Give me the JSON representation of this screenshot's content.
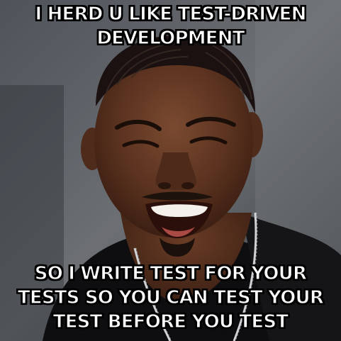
{
  "meme": {
    "top_text": "I HERD U LIKE TEST-DRIVEN DEVELOPMENT",
    "bottom_text": "SO I WRITE TEST FOR YOUR TESTS SO YOU CAN TEST YOUR TEST BEFORE YOU TEST"
  },
  "colors": {
    "caption_fill": "#ffffff",
    "caption_outline": "#000000"
  },
  "icons": {
    "background": "laughing-man-photo"
  }
}
